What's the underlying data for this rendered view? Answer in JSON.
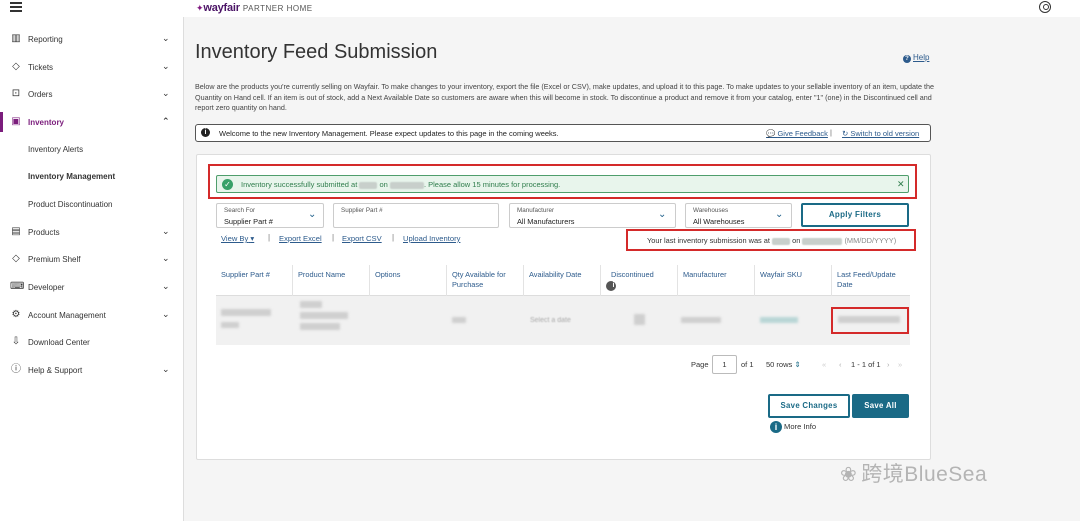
{
  "header": {
    "logo": "wayfair",
    "logo_suffix": "PARTNER HOME"
  },
  "sidebar": {
    "items": [
      {
        "label": "Reporting",
        "icon": "chart-icon"
      },
      {
        "label": "Tickets",
        "icon": "tag-icon"
      },
      {
        "label": "Orders",
        "icon": "bag-icon"
      },
      {
        "label": "Inventory",
        "icon": "inventory-icon"
      },
      {
        "label": "Products",
        "icon": "product-icon"
      },
      {
        "label": "Premium Shelf",
        "icon": "tag-icon"
      },
      {
        "label": "Developer",
        "icon": "code-icon"
      },
      {
        "label": "Account Management",
        "icon": "gear-icon"
      },
      {
        "label": "Download Center",
        "icon": "download-icon"
      },
      {
        "label": "Help & Support",
        "icon": "help-icon"
      }
    ],
    "inventory_sub": [
      "Inventory Alerts",
      "Inventory Management",
      "Product Discontinuation"
    ]
  },
  "page": {
    "title": "Inventory Feed Submission",
    "help": "Help",
    "description": "Below are the products you're currently selling on Wayfair. To make changes to your inventory, export the file (Excel or CSV), make updates, and upload it to this page. To make updates to your sellable inventory of an item, update the Quantity on Hand cell. If an item is out of stock, add a Next Available Date so customers are aware when this will become in stock. To discontinue a product and remove it from your catalog, enter \"1\" (one) in the Discontinued cell and report zero quantity on hand."
  },
  "notice": {
    "text": "Welcome to the new Inventory Management. Please expect updates to this page in the coming weeks.",
    "feedback": "Give Feedback",
    "separator": "|",
    "switch": "Switch to old version"
  },
  "success": {
    "prefix": "Inventory successfully submitted at",
    "on": "on",
    "suffix": ". Please allow 15 minutes for processing."
  },
  "filters": {
    "search_for_label": "Search For",
    "search_for_value": "Supplier Part #",
    "supplier_part_label": "Supplier Part #",
    "manufacturer_label": "Manufacturer",
    "manufacturer_value": "All Manufacturers",
    "warehouses_label": "Warehouses",
    "warehouses_value": "All Warehouses",
    "apply": "Apply Filters"
  },
  "actions": {
    "view_by": "View By",
    "export_excel": "Export Excel",
    "export_csv": "Export CSV",
    "upload": "Upload Inventory",
    "sep": "|"
  },
  "last_submission": {
    "text": "Your last inventory submission was at",
    "on": "on",
    "format": "(MM/DD/YYYY)"
  },
  "table": {
    "columns": [
      "Supplier Part #",
      "Product Name",
      "Options",
      "Qty Available for Purchase",
      "Availability Date",
      "Discontinued",
      "Manufacturer",
      "Wayfair SKU",
      "Last Feed/Update Date"
    ],
    "select_date": "Select a date"
  },
  "pagination": {
    "page_label": "Page",
    "page_value": "1",
    "of": "of 1",
    "rows": "50 rows",
    "range": "1 - 1 of 1"
  },
  "buttons": {
    "save_changes": "Save Changes",
    "save_all": "Save All",
    "more_info": "More Info"
  },
  "watermark": "跨境BlueSea",
  "colors": {
    "brand": "#7b1d7c",
    "primary": "#1a6a86",
    "link": "#2d5b8c",
    "success_bg": "#e8f5ec",
    "highlight": "#d42a2a"
  }
}
